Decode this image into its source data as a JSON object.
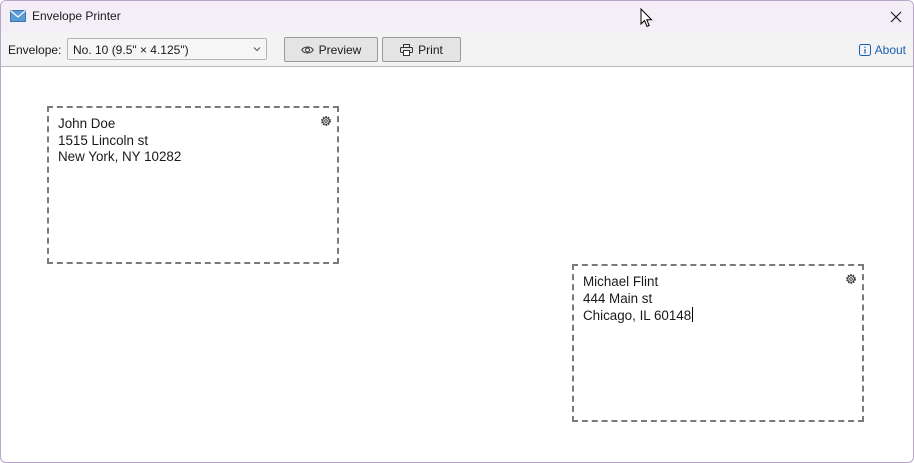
{
  "window": {
    "title": "Envelope Printer",
    "app_icon": "envelope-icon",
    "close_icon": "close-icon"
  },
  "toolbar": {
    "envelope_label": "Envelope:",
    "envelope_value": "No. 10 (9.5\" × 4.125\")",
    "preview_label": "Preview",
    "preview_icon": "eye-icon",
    "print_label": "Print",
    "print_icon": "printer-icon",
    "about_label": "About",
    "about_icon": "info-icon"
  },
  "envelopes": [
    {
      "lines": [
        "John Doe",
        "1515 Lincoln st",
        "New York, NY 10282"
      ],
      "icon": "gear-icon"
    },
    {
      "lines": [
        "Michael Flint",
        "444 Main st",
        "Chicago, IL 60148"
      ],
      "icon": "gear-icon"
    }
  ],
  "colors": {
    "titlebar": "#f4eef7",
    "toolbar": "#f3f3f3",
    "accent": "#1a5fb4",
    "dashed_border": "#7a7a7a"
  }
}
